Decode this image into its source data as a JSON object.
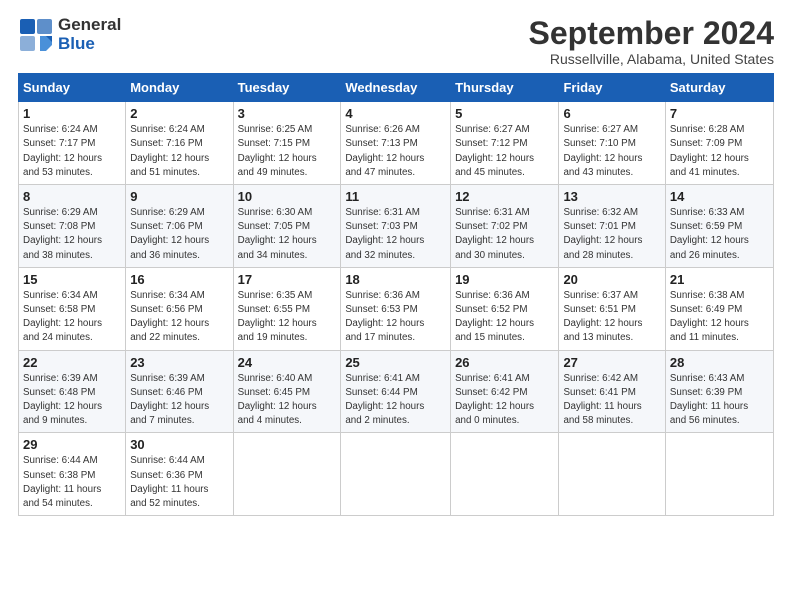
{
  "header": {
    "logo_line1": "General",
    "logo_line2": "Blue",
    "title": "September 2024",
    "subtitle": "Russellville, Alabama, United States"
  },
  "weekdays": [
    "Sunday",
    "Monday",
    "Tuesday",
    "Wednesday",
    "Thursday",
    "Friday",
    "Saturday"
  ],
  "weeks": [
    [
      {
        "day": "1",
        "info": "Sunrise: 6:24 AM\nSunset: 7:17 PM\nDaylight: 12 hours\nand 53 minutes."
      },
      {
        "day": "2",
        "info": "Sunrise: 6:24 AM\nSunset: 7:16 PM\nDaylight: 12 hours\nand 51 minutes."
      },
      {
        "day": "3",
        "info": "Sunrise: 6:25 AM\nSunset: 7:15 PM\nDaylight: 12 hours\nand 49 minutes."
      },
      {
        "day": "4",
        "info": "Sunrise: 6:26 AM\nSunset: 7:13 PM\nDaylight: 12 hours\nand 47 minutes."
      },
      {
        "day": "5",
        "info": "Sunrise: 6:27 AM\nSunset: 7:12 PM\nDaylight: 12 hours\nand 45 minutes."
      },
      {
        "day": "6",
        "info": "Sunrise: 6:27 AM\nSunset: 7:10 PM\nDaylight: 12 hours\nand 43 minutes."
      },
      {
        "day": "7",
        "info": "Sunrise: 6:28 AM\nSunset: 7:09 PM\nDaylight: 12 hours\nand 41 minutes."
      }
    ],
    [
      {
        "day": "8",
        "info": "Sunrise: 6:29 AM\nSunset: 7:08 PM\nDaylight: 12 hours\nand 38 minutes."
      },
      {
        "day": "9",
        "info": "Sunrise: 6:29 AM\nSunset: 7:06 PM\nDaylight: 12 hours\nand 36 minutes."
      },
      {
        "day": "10",
        "info": "Sunrise: 6:30 AM\nSunset: 7:05 PM\nDaylight: 12 hours\nand 34 minutes."
      },
      {
        "day": "11",
        "info": "Sunrise: 6:31 AM\nSunset: 7:03 PM\nDaylight: 12 hours\nand 32 minutes."
      },
      {
        "day": "12",
        "info": "Sunrise: 6:31 AM\nSunset: 7:02 PM\nDaylight: 12 hours\nand 30 minutes."
      },
      {
        "day": "13",
        "info": "Sunrise: 6:32 AM\nSunset: 7:01 PM\nDaylight: 12 hours\nand 28 minutes."
      },
      {
        "day": "14",
        "info": "Sunrise: 6:33 AM\nSunset: 6:59 PM\nDaylight: 12 hours\nand 26 minutes."
      }
    ],
    [
      {
        "day": "15",
        "info": "Sunrise: 6:34 AM\nSunset: 6:58 PM\nDaylight: 12 hours\nand 24 minutes."
      },
      {
        "day": "16",
        "info": "Sunrise: 6:34 AM\nSunset: 6:56 PM\nDaylight: 12 hours\nand 22 minutes."
      },
      {
        "day": "17",
        "info": "Sunrise: 6:35 AM\nSunset: 6:55 PM\nDaylight: 12 hours\nand 19 minutes."
      },
      {
        "day": "18",
        "info": "Sunrise: 6:36 AM\nSunset: 6:53 PM\nDaylight: 12 hours\nand 17 minutes."
      },
      {
        "day": "19",
        "info": "Sunrise: 6:36 AM\nSunset: 6:52 PM\nDaylight: 12 hours\nand 15 minutes."
      },
      {
        "day": "20",
        "info": "Sunrise: 6:37 AM\nSunset: 6:51 PM\nDaylight: 12 hours\nand 13 minutes."
      },
      {
        "day": "21",
        "info": "Sunrise: 6:38 AM\nSunset: 6:49 PM\nDaylight: 12 hours\nand 11 minutes."
      }
    ],
    [
      {
        "day": "22",
        "info": "Sunrise: 6:39 AM\nSunset: 6:48 PM\nDaylight: 12 hours\nand 9 minutes."
      },
      {
        "day": "23",
        "info": "Sunrise: 6:39 AM\nSunset: 6:46 PM\nDaylight: 12 hours\nand 7 minutes."
      },
      {
        "day": "24",
        "info": "Sunrise: 6:40 AM\nSunset: 6:45 PM\nDaylight: 12 hours\nand 4 minutes."
      },
      {
        "day": "25",
        "info": "Sunrise: 6:41 AM\nSunset: 6:44 PM\nDaylight: 12 hours\nand 2 minutes."
      },
      {
        "day": "26",
        "info": "Sunrise: 6:41 AM\nSunset: 6:42 PM\nDaylight: 12 hours\nand 0 minutes."
      },
      {
        "day": "27",
        "info": "Sunrise: 6:42 AM\nSunset: 6:41 PM\nDaylight: 11 hours\nand 58 minutes."
      },
      {
        "day": "28",
        "info": "Sunrise: 6:43 AM\nSunset: 6:39 PM\nDaylight: 11 hours\nand 56 minutes."
      }
    ],
    [
      {
        "day": "29",
        "info": "Sunrise: 6:44 AM\nSunset: 6:38 PM\nDaylight: 11 hours\nand 54 minutes."
      },
      {
        "day": "30",
        "info": "Sunrise: 6:44 AM\nSunset: 6:36 PM\nDaylight: 11 hours\nand 52 minutes."
      },
      {
        "day": "",
        "info": ""
      },
      {
        "day": "",
        "info": ""
      },
      {
        "day": "",
        "info": ""
      },
      {
        "day": "",
        "info": ""
      },
      {
        "day": "",
        "info": ""
      }
    ]
  ]
}
